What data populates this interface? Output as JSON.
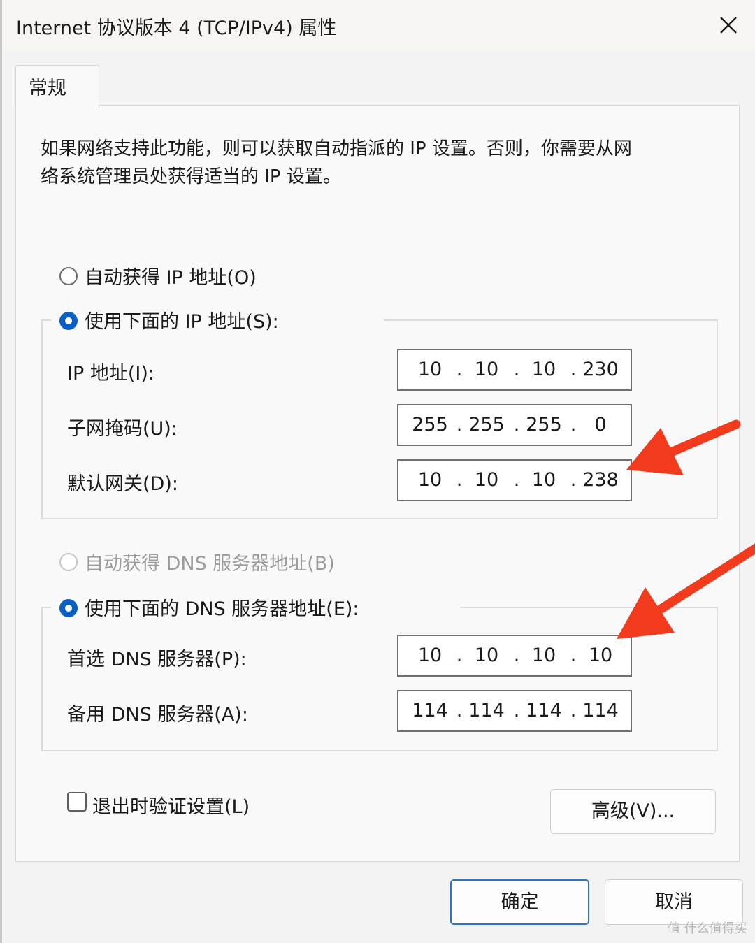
{
  "window": {
    "title": "Internet 协议版本 4 (TCP/IPv4) 属性",
    "close_glyph": "✕"
  },
  "tabs": [
    {
      "label": "常规",
      "selected": true
    }
  ],
  "description": {
    "line1": "如果网络支持此功能，则可以获取自动指派的 IP 设置。否则，你需要从网",
    "line2": "络系统管理员处获得适当的 IP 设置。"
  },
  "ip_section": {
    "auto_option": {
      "label": "自动获得 IP 地址(O)",
      "selected": false
    },
    "manual_option": {
      "label": "使用下面的 IP 地址(S):",
      "selected": true
    },
    "fields": [
      {
        "label": "IP 地址(I):",
        "octets": [
          "10",
          "10",
          "10",
          "230"
        ]
      },
      {
        "label": "子网掩码(U):",
        "octets": [
          "255",
          "255",
          "255",
          "0"
        ]
      },
      {
        "label": "默认网关(D):",
        "octets": [
          "10",
          "10",
          "10",
          "238"
        ]
      }
    ]
  },
  "dns_section": {
    "auto_option": {
      "label": "自动获得 DNS 服务器地址(B)",
      "selected": false,
      "disabled": true
    },
    "manual_option": {
      "label": "使用下面的 DNS 服务器地址(E):",
      "selected": true
    },
    "fields": [
      {
        "label": "首选 DNS 服务器(P):",
        "octets": [
          "10",
          "10",
          "10",
          "10"
        ]
      },
      {
        "label": "备用 DNS 服务器(A):",
        "octets": [
          "114",
          "114",
          "114",
          "114"
        ]
      }
    ]
  },
  "validate_checkbox": {
    "label": "退出时验证设置(L)",
    "checked": false
  },
  "buttons": {
    "advanced": "高级(V)...",
    "ok": "确定",
    "cancel": "取消"
  },
  "annotations": {
    "arrow_color": "#f23a1c",
    "arrow_icon": "red-arrow-icon"
  },
  "watermark": "值 什么值得买",
  "colors": {
    "accent": "#0a5fc4",
    "default_button_border": "#2b74c9"
  }
}
